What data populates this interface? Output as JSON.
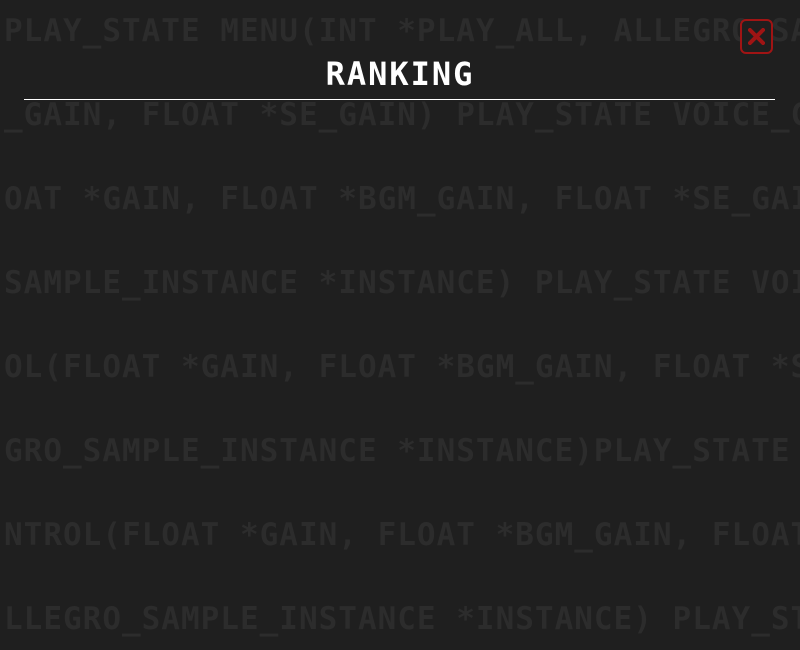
{
  "background_lines": [
    "PLAY_STATE MENU(INT *PLAY_ALL, ALLEGRO_SAMPLE_INSTANCE",
    "_GAIN, FLOAT *SE_GAIN) PLAY_STATE VOICE_CONTROL(",
    "OAT *GAIN, FLOAT *BGM_GAIN, FLOAT *SE_GAIN) PLAY",
    "SAMPLE_INSTANCE *INSTANCE) PLAY_STATE VOICE_CONTROL",
    "OL(FLOAT *GAIN, FLOAT *BGM_GAIN, FLOAT *SE_GAIN)",
    "GRO_SAMPLE_INSTANCE *INSTANCE)PLAY_STATE VOICE",
    "NTROL(FLOAT *GAIN, FLOAT *BGM_GAIN, FLOAT *SE",
    "LLEGRO_SAMPLE_INSTANCE *INSTANCE) PLAY_STATE"
  ],
  "header": {
    "title": "RANKING"
  },
  "close_button": {
    "icon": "close-icon",
    "color": "#a01414"
  },
  "colors": {
    "background": "#1f1f1f",
    "background_text": "#2c2c2c",
    "title": "#ffffff",
    "accent": "#a01414"
  }
}
